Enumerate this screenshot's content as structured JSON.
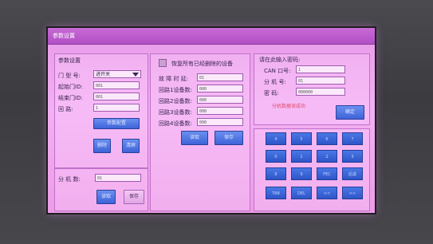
{
  "window": {
    "title": "参数设置"
  },
  "left": {
    "section_title": "参数设置",
    "door_type": {
      "label": "门 型 号:",
      "value": "进开关"
    },
    "start_door": {
      "label": "起始门ID:",
      "value": "001"
    },
    "end_door": {
      "label": "结束门ID:",
      "value": "001"
    },
    "loop": {
      "label": "回    路:",
      "value": "1"
    },
    "add_button": "参数配置",
    "delete_button": "删除",
    "clear_button": "清屏",
    "slaves": {
      "label": "分 机 数:",
      "value": "01"
    },
    "read_button": "读取",
    "save_button": "保存"
  },
  "middle": {
    "checkbox_label": "恢复所有已经删除的设备",
    "fault_time": {
      "label": "故 障 时 延:",
      "value": "01"
    },
    "loop1": {
      "label": "回路1设备数:",
      "value": "000"
    },
    "loop2": {
      "label": "回路2设备数:",
      "value": "000"
    },
    "loop3": {
      "label": "回路3设备数:",
      "value": "000"
    },
    "loop4": {
      "label": "回路4设备数:",
      "value": "000"
    },
    "read_button": "读取",
    "save_button": "保存"
  },
  "right": {
    "section_title": "请在此输入密码:",
    "can": {
      "label": "CAN 口号:",
      "value": "1"
    },
    "slave_no": {
      "label": "分 机 号:",
      "value": "01"
    },
    "password": {
      "label": "密    码:",
      "value": "000000"
    },
    "status": "分机数据读成功",
    "confirm_button": "确定",
    "keypad": [
      [
        "4",
        "5",
        "6",
        "7"
      ],
      [
        "0",
        "1",
        "2",
        "3"
      ],
      [
        "8",
        "9",
        "FEC",
        "后退"
      ],
      [
        "TAB",
        "DEL",
        "<<",
        ">>"
      ]
    ]
  }
}
